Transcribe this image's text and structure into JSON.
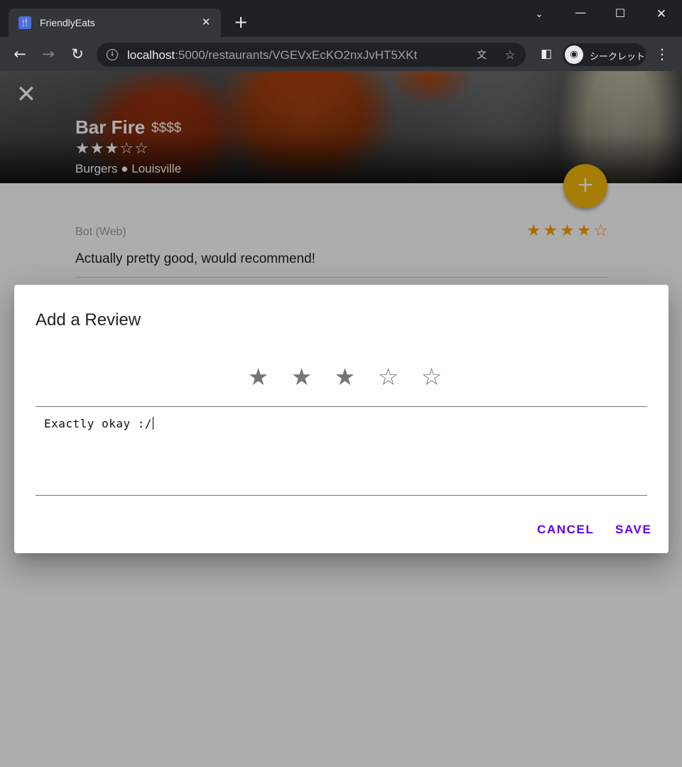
{
  "browser": {
    "tab_title": "FriendlyEats",
    "tab_favicon": "fork-knife-icon",
    "url_host": "localhost",
    "url_path": ":5000/restaurants/VGEVxEcKO2nxJvHT5XKt",
    "incognito_label": "シークレット"
  },
  "restaurant": {
    "name": "Bar Fire",
    "price": "$$$$",
    "rating": 3,
    "stars": [
      "★",
      "★",
      "★",
      "☆",
      "☆"
    ],
    "category_city": "Burgers ● Louisville"
  },
  "review": {
    "user": "Bot (Web)",
    "rating": 4,
    "stars": [
      "★",
      "★",
      "★",
      "★",
      "☆"
    ],
    "text": "Actually pretty good, would recommend!"
  },
  "dialog": {
    "title": "Add a Review",
    "rating": 3,
    "stars": [
      "★",
      "★",
      "★",
      "☆",
      "☆"
    ],
    "text_value": "Exactly okay :/",
    "cancel_label": "CANCEL",
    "save_label": "SAVE"
  },
  "colors": {
    "accent": "#6200ee",
    "fab": "#f5b90a",
    "review_star": "#ffa000"
  },
  "icons": {
    "hero_close": "close-icon",
    "fab": "add-icon"
  }
}
